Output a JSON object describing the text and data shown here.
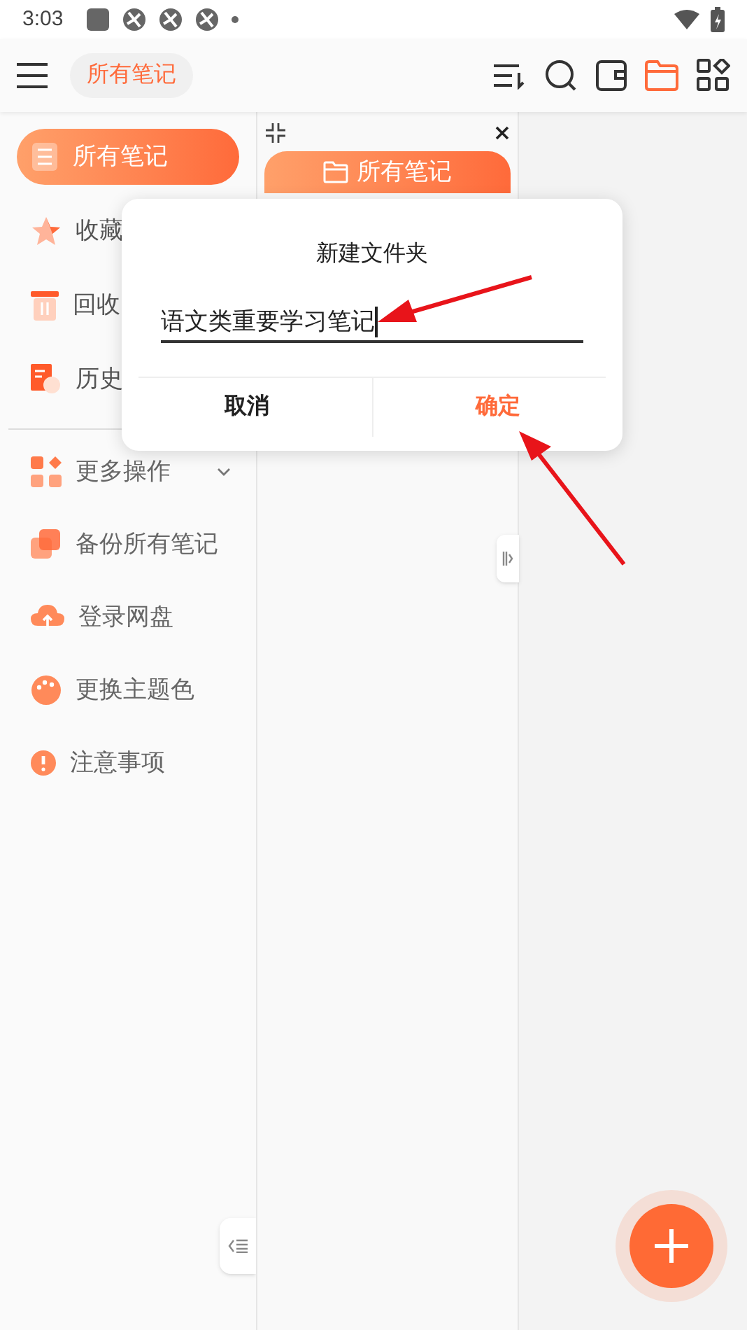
{
  "status_bar": {
    "time": "3:03"
  },
  "toolbar": {
    "title_chip": "所有笔记",
    "icons": [
      {
        "selected": false
      },
      {
        "selected": false
      },
      {
        "selected": false
      },
      {
        "selected": true
      },
      {
        "selected": false
      }
    ]
  },
  "sidebar": {
    "items": [
      {
        "label": "所有笔记",
        "selected": true
      },
      {
        "label": "收藏",
        "selected": false
      },
      {
        "label": "回收",
        "selected": false
      },
      {
        "label": "历史",
        "selected": false
      }
    ],
    "more_items": [
      {
        "label": "更多操作",
        "expanded": false
      },
      {
        "label": "备份所有笔记"
      },
      {
        "label": "登录网盘"
      },
      {
        "label": "更换主题色"
      },
      {
        "label": "注意事项"
      }
    ]
  },
  "folder_panel": {
    "folders": [
      {
        "label": "所有笔记",
        "selected": true
      }
    ]
  },
  "dialog": {
    "title": "新建文件夹",
    "value": "语文类重要学习笔记",
    "buttons": [
      {
        "label": "取消",
        "kind": "cancel"
      },
      {
        "label": "确定",
        "kind": "confirm"
      }
    ]
  }
}
